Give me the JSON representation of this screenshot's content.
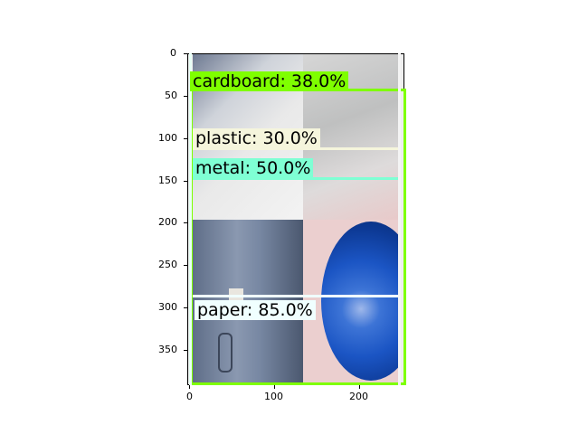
{
  "detections": [
    {
      "label": "cardboard: 38.0%",
      "color": "#7fff00"
    },
    {
      "label": "plastic: 30.0%",
      "color": "#f5f5dc"
    },
    {
      "label": "metal: 50.0%",
      "color": "#7fffd4"
    },
    {
      "label": "paper: 85.0%",
      "color": "#f0ffff"
    }
  ],
  "axes": {
    "y_ticks": [
      "0",
      "50",
      "100",
      "150",
      "200",
      "250",
      "300",
      "350"
    ],
    "x_ticks": [
      "0",
      "100",
      "200"
    ]
  },
  "colors": {
    "cardboard_tile": "#c9c9c9",
    "plastic_tile": "#d8d8d8",
    "paper_tile": "#6f7f9a",
    "metal_tile": "#e8c9c9",
    "disc": "#1f5fd6"
  }
}
